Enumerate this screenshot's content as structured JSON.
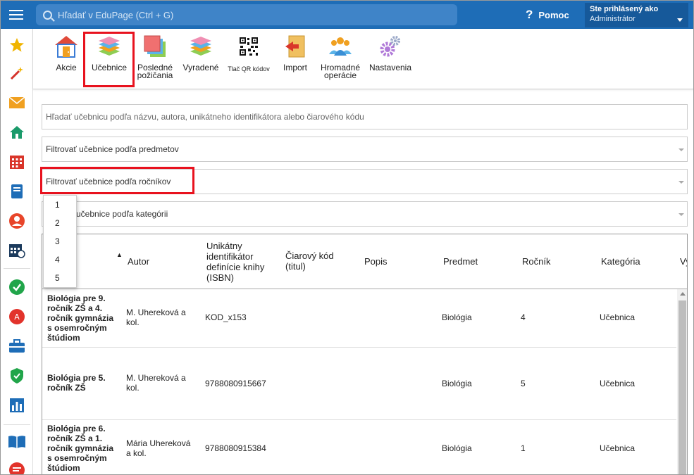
{
  "topbar": {
    "search_placeholder": "Hľadať v EduPage (Ctrl + G)",
    "help_label": "Pomoc",
    "user_line1": "Ste prihlásený ako",
    "user_line2": "Administrátor"
  },
  "toolbar": {
    "items": [
      {
        "label": "Akcie",
        "icon": "door-icon"
      },
      {
        "label": "Učebnice",
        "icon": "books-stack-icon"
      },
      {
        "label1": "Posledné",
        "label2": "požičania",
        "icon": "recent-loans-icon"
      },
      {
        "label": "Vyradené",
        "icon": "discarded-books-icon"
      },
      {
        "label": "Tlač QR kódov",
        "icon": "qr-code-icon"
      },
      {
        "label": "Import",
        "icon": "import-icon"
      },
      {
        "label1": "Hromadné",
        "label2": "operácie",
        "icon": "group-users-icon"
      },
      {
        "label": "Nastavenia",
        "icon": "gears-icon"
      }
    ]
  },
  "filters": {
    "search": "Hľadať učebnicu podľa názvu, autora, unikátneho identifikátora alebo čiarového kódu",
    "subjects": "Filtrovať učebnice podľa predmetov",
    "grades": "Filtrovať učebnice podľa ročníkov",
    "categories_partial": "učebnice podľa kategórii"
  },
  "grade_options": [
    "1",
    "2",
    "3",
    "4",
    "5"
  ],
  "table": {
    "columns": {
      "autor": "Autor",
      "isbn_l1": "Unikátny",
      "isbn_l2": "identifikátor",
      "isbn_l3": "definície knihy",
      "isbn_l4": "(ISBN)",
      "barcode_l1": "Čiarový kód",
      "barcode_l2": "(titul)",
      "popis": "Popis",
      "predmet": "Predmet",
      "rocnik": "Ročník",
      "kategoria": "Kategória",
      "cut": "Vy"
    },
    "rows": [
      {
        "title": [
          "Biológia pre 9.",
          "ročník ZŠ a 4.",
          "ročník gymnázia",
          "s osemročným",
          "štúdiom"
        ],
        "author": [
          "M. Uhereková a",
          "kol."
        ],
        "isbn": "KOD_x153",
        "subject": "Biológia",
        "grade": "4",
        "category": "Učebnica"
      },
      {
        "title": [
          "Biológia pre 5.",
          "ročník ZŠ"
        ],
        "author": [
          "M. Uhereková a",
          "kol."
        ],
        "isbn": "9788080915667",
        "subject": "Biológia",
        "grade": "5",
        "category": "Učebnica"
      },
      {
        "title": [
          "Biológia pre 6.",
          "ročník ZŠ a 1.",
          "ročník gymnázia",
          "s osemročným",
          "štúdiom"
        ],
        "author": [
          "Mária Uhereková",
          "a kol."
        ],
        "isbn": "9788080915384",
        "subject": "Biológia",
        "grade": "1",
        "category": "Učebnica"
      }
    ]
  }
}
